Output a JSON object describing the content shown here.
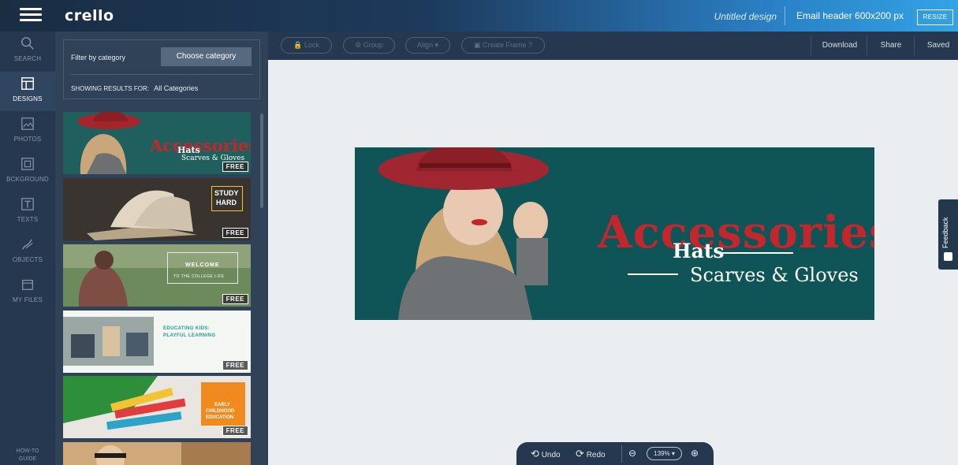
{
  "app": {
    "logo": "crello",
    "design_title": "Untitled design",
    "format_label": "Email header 600x200 px",
    "resize_label": "RESIZE"
  },
  "nav": {
    "items": [
      {
        "label": "SEARCH",
        "icon": "search-icon"
      },
      {
        "label": "DESIGNS",
        "icon": "designs-icon",
        "active": true
      },
      {
        "label": "PHOTOS",
        "icon": "photo-icon"
      },
      {
        "label": "BCKGROUND",
        "icon": "background-icon"
      },
      {
        "label": "TEXTS",
        "icon": "text-icon"
      },
      {
        "label": "OBJECTS",
        "icon": "objects-icon"
      },
      {
        "label": "MY FILES",
        "icon": "folder-icon"
      }
    ],
    "howto_line1": "HOW-TO",
    "howto_line2": "GUIDE"
  },
  "panel": {
    "filter_label": "Filter by category",
    "choose_category": "Choose category",
    "showing_label": "SHOWING RESULTS FOR:",
    "showing_value": "All Categories",
    "tiles": [
      {
        "title": "Accessories",
        "line1": "Hats",
        "line2": "Scarves & Gloves",
        "badge": "FREE"
      },
      {
        "line1": "STUDY",
        "line2": "HARD",
        "badge": "FREE"
      },
      {
        "line1": "WELCOME",
        "line2": "TO THE COLLEGE LIFE",
        "badge": "FREE"
      },
      {
        "line1": "EDUCATING KIDS:",
        "line2": "PLAYFUL LEARNING",
        "badge": "FREE"
      },
      {
        "line1": "EARLY",
        "line2": "CHILDHOOD",
        "line3": "EDUCATION",
        "badge": "FREE"
      }
    ]
  },
  "toolbar": {
    "lock": "Lock",
    "group": "Group",
    "align": "Align ▾",
    "create_frame": "Create Frame",
    "download": "Download",
    "share": "Share",
    "saved": "Saved"
  },
  "artwork": {
    "title": "Accessories",
    "line1": "Hats",
    "line2": "Scarves & Gloves"
  },
  "feedback": "Feedback",
  "bottom": {
    "undo": "Undo",
    "redo": "Redo",
    "zoom": "139% ▾"
  },
  "colors": {
    "accent_red": "#c2272d",
    "artwork_bg": "#0f5456",
    "topbar_right": "#33a3e4"
  }
}
